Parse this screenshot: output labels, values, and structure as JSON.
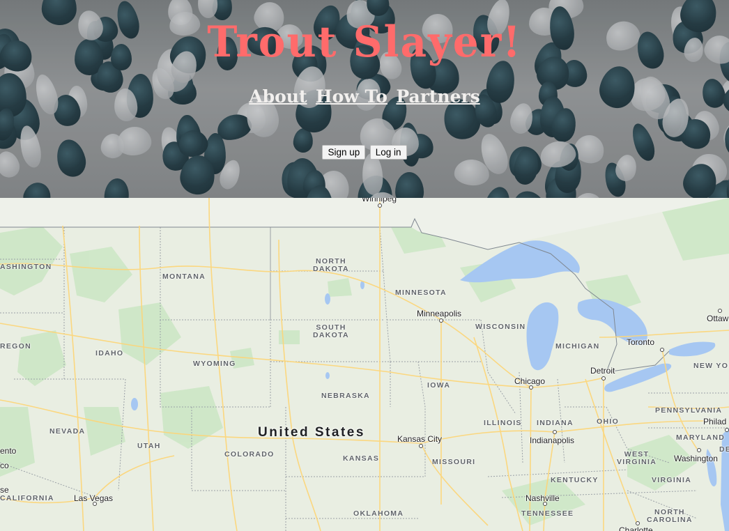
{
  "header": {
    "title": "Trout Slayer!",
    "nav": [
      {
        "label": "About"
      },
      {
        "label": "How To"
      },
      {
        "label": "Partners"
      }
    ],
    "buttons": {
      "signup": "Sign up",
      "login": "Log in"
    },
    "colors": {
      "title": "#ff6b6b",
      "nav": "#f2f0ee"
    }
  },
  "map": {
    "country_label": "United States",
    "states": {
      "washington": "ASHINGTON",
      "oregon": "REGON",
      "california": "CALIFORNIA",
      "montana": "MONTANA",
      "idaho": "IDAHO",
      "wyoming": "WYOMING",
      "nevada": "NEVADA",
      "utah": "UTAH",
      "colorado": "COLORADO",
      "north_dakota": "NORTH\nDAKOTA",
      "south_dakota": "SOUTH\nDAKOTA",
      "nebraska": "NEBRASKA",
      "kansas": "KANSAS",
      "oklahoma": "OKLAHOMA",
      "minnesota": "MINNESOTA",
      "iowa": "IOWA",
      "missouri": "MISSOURI",
      "wisconsin": "WISCONSIN",
      "illinois": "ILLINOIS",
      "michigan": "MICHIGAN",
      "indiana": "INDIANA",
      "ohio": "OHIO",
      "kentucky": "KENTUCKY",
      "tennessee": "TENNESSEE",
      "west_virginia": "WEST\nVIRGINIA",
      "virginia": "VIRGINIA",
      "north_carolina": "NORTH\nCAROLINA",
      "pennsylvania": "PENNSYLVANIA",
      "new_york": "NEW YOR",
      "maryland": "MARYLAND",
      "delaware": "DE"
    },
    "cities": {
      "winnipeg": "Winnipeg",
      "minneapolis": "Minneapolis",
      "chicago": "Chicago",
      "detroit": "Detroit",
      "toronto": "Toronto",
      "ottawa": "Ottaw",
      "kansas_city": "Kansas City",
      "indianapolis": "Indianapolis",
      "washington": "Washington",
      "philadelphia": "Philad",
      "nashville": "Nashville",
      "charlotte": "Charlotte",
      "las_vegas": "Las Vegas",
      "sacramento": "ento",
      "sf": "co",
      "sj": "se"
    },
    "colors": {
      "water": "#a6c7f2",
      "land": "#e9eee2",
      "park": "#c8e6c3",
      "road": "#fcd67a",
      "border": "#9aa0a6"
    }
  }
}
